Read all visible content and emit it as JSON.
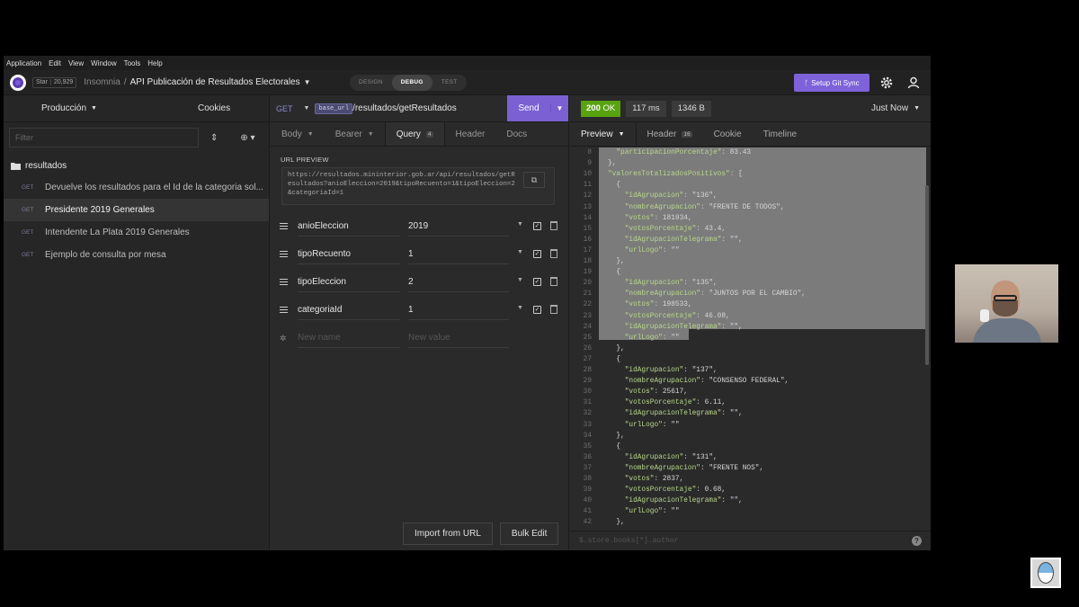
{
  "menu": [
    "Application",
    "Edit",
    "View",
    "Window",
    "Tools",
    "Help"
  ],
  "titlebar": {
    "github_star": "Star",
    "github_count": "20,929",
    "app": "Insomnia",
    "separator": "/",
    "project": "API Publicación de Resultados Electorales",
    "modes": [
      "DESIGN",
      "DEBUG",
      "TEST"
    ],
    "active_mode": "DEBUG",
    "git_button": "Setup Git Sync"
  },
  "sidebar": {
    "environment": "Producción",
    "cookies": "Cookies",
    "filter_placeholder": "Filter",
    "folder": "resultados",
    "requests": [
      {
        "method": "GET",
        "name": "Devuelve los resultados para el Id de la categoria sol..."
      },
      {
        "method": "GET",
        "name": "Presidente 2019 Generales"
      },
      {
        "method": "GET",
        "name": "Intendente La Plata 2019 Generales"
      },
      {
        "method": "GET",
        "name": "Ejemplo de consulta por mesa"
      }
    ]
  },
  "request": {
    "method": "GET",
    "base_url_tag": "base_url",
    "path": "/resultados/getResultados",
    "send": "Send",
    "tabs": {
      "body": "Body",
      "bearer": "Bearer",
      "query": "Query",
      "query_count": "4",
      "header": "Header",
      "docs": "Docs"
    },
    "url_preview_label": "URL PREVIEW",
    "url_preview": "https://resultados.mininterior.gob.ar/api/resultados/getResultados?anioEleccion=2019&tipoRecuento=1&tipoEleccion=2&categoriaId=1",
    "params": [
      {
        "name": "anioEleccion",
        "value": "2019"
      },
      {
        "name": "tipoRecuento",
        "value": "1"
      },
      {
        "name": "tipoEleccion",
        "value": "2"
      },
      {
        "name": "categoriaId",
        "value": "1"
      }
    ],
    "new_name_placeholder": "New name",
    "new_value_placeholder": "New value",
    "import_button": "Import from URL",
    "bulk_button": "Bulk Edit"
  },
  "response": {
    "status_code": "200",
    "status_text": "OK",
    "time": "117 ms",
    "size": "1346 B",
    "when": "Just Now",
    "tabs": {
      "preview": "Preview",
      "header": "Header",
      "header_count": "16",
      "cookie": "Cookie",
      "timeline": "Timeline"
    },
    "filter_placeholder": "$.store.books[*].author",
    "code_lines": [
      {
        "ln": "8",
        "text": "  \"participacionPorcentaje\": 83.43"
      },
      {
        "ln": "9",
        "text": "},"
      },
      {
        "ln": "10",
        "text": "\"valoresTotalizadosPositivos\": ["
      },
      {
        "ln": "11",
        "text": "  {"
      },
      {
        "ln": "12",
        "text": "    \"idAgrupacion\": \"136\","
      },
      {
        "ln": "13",
        "text": "    \"nombreAgrupacion\": \"FRENTE DE TODOS\","
      },
      {
        "ln": "14",
        "text": "    \"votos\": 181934,"
      },
      {
        "ln": "15",
        "text": "    \"votosPorcentaje\": 43.4,"
      },
      {
        "ln": "16",
        "text": "    \"idAgrupacionTelegrama\": \"\","
      },
      {
        "ln": "17",
        "text": "    \"urlLogo\": \"\""
      },
      {
        "ln": "18",
        "text": "  },"
      },
      {
        "ln": "19",
        "text": "  {"
      },
      {
        "ln": "20",
        "text": "    \"idAgrupacion\": \"135\","
      },
      {
        "ln": "21",
        "text": "    \"nombreAgrupacion\": \"JUNTOS POR EL CAMBIO\","
      },
      {
        "ln": "22",
        "text": "    \"votos\": 198533,"
      },
      {
        "ln": "23",
        "text": "    \"votosPorcentaje\": 46.08,"
      },
      {
        "ln": "24",
        "text": "    \"idAgrupacionTelegrama\": \"\","
      },
      {
        "ln": "25",
        "text": "    \"urlLogo\": \"\""
      },
      {
        "ln": "26",
        "text": "  },"
      },
      {
        "ln": "27",
        "text": "  {"
      },
      {
        "ln": "28",
        "text": "    \"idAgrupacion\": \"137\","
      },
      {
        "ln": "29",
        "text": "    \"nombreAgrupacion\": \"CONSENSO FEDERAL\","
      },
      {
        "ln": "30",
        "text": "    \"votos\": 25617,"
      },
      {
        "ln": "31",
        "text": "    \"votosPorcentaje\": 6.11,"
      },
      {
        "ln": "32",
        "text": "    \"idAgrupacionTelegrama\": \"\","
      },
      {
        "ln": "33",
        "text": "    \"urlLogo\": \"\""
      },
      {
        "ln": "34",
        "text": "  },"
      },
      {
        "ln": "35",
        "text": "  {"
      },
      {
        "ln": "36",
        "text": "    \"idAgrupacion\": \"131\","
      },
      {
        "ln": "37",
        "text": "    \"nombreAgrupacion\": \"FRENTE NOS\","
      },
      {
        "ln": "38",
        "text": "    \"votos\": 2837,"
      },
      {
        "ln": "39",
        "text": "    \"votosPorcentaje\": 0.68,"
      },
      {
        "ln": "40",
        "text": "    \"idAgrupacionTelegrama\": \"\","
      },
      {
        "ln": "41",
        "text": "    \"urlLogo\": \"\""
      },
      {
        "ln": "42",
        "text": "  },"
      }
    ]
  },
  "colors": {
    "accent": "#7a60d3",
    "ok": "#59a210"
  }
}
